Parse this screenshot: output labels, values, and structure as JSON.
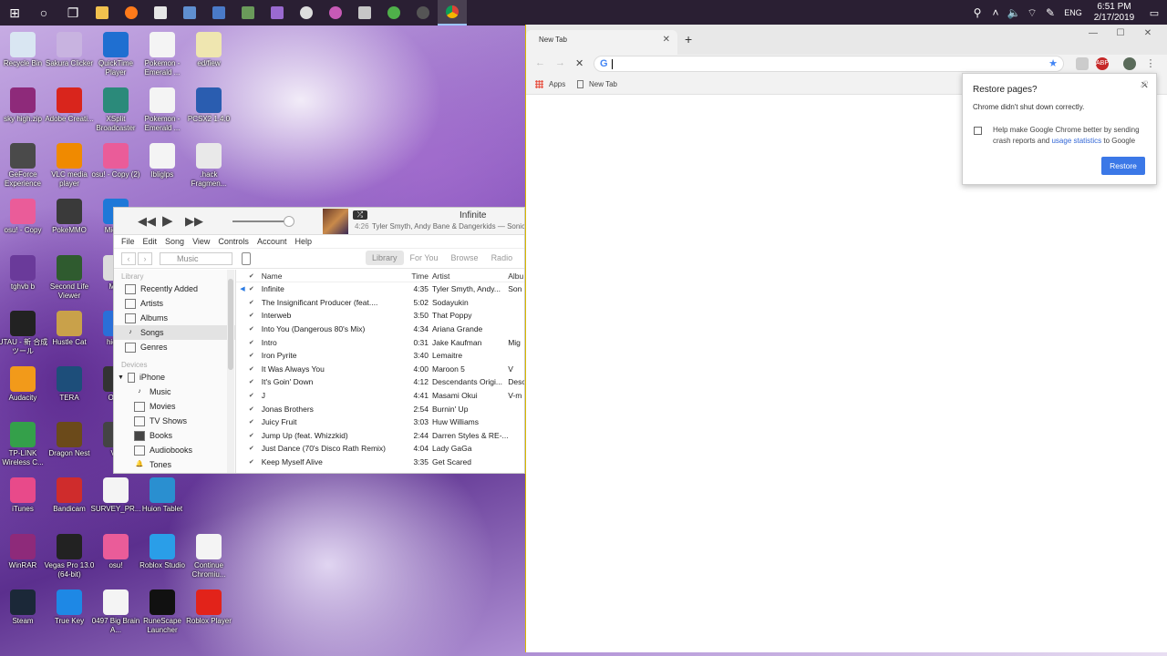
{
  "taskbar": {
    "apps": [
      "windows-start",
      "cortana",
      "task-view",
      "file-explorer",
      "firefox",
      "store",
      "app-1",
      "app-2",
      "app-3",
      "app-4",
      "itunes",
      "app-5",
      "app-6",
      "app-7",
      "app-8",
      "chrome"
    ],
    "tray": {
      "lang": "ENG",
      "time": "6:51 PM",
      "date": "2/17/2019"
    }
  },
  "desktop": {
    "icons": [
      {
        "label": "Recycle Bin",
        "color": "#d9e6f2"
      },
      {
        "label": "Sakura Clicker",
        "color": "#c8b3e0"
      },
      {
        "label": "QuickTime Player",
        "color": "#1f6fd1"
      },
      {
        "label": "Pokemon - Emerald ...",
        "color": "#f4f4f4"
      },
      {
        "label": "ed/fiew",
        "color": "#efe6b0"
      },
      {
        "label": "sky high.zip",
        "color": "#8e2a7a"
      },
      {
        "label": "Adobe Creati...",
        "color": "#d9251c"
      },
      {
        "label": "XSplit Broadcaster",
        "color": "#2b8a7a"
      },
      {
        "label": "Pokemon - Emerald ...",
        "color": "#f4f4f4"
      },
      {
        "label": "PCSX2 1.4.0",
        "color": "#2a5db0"
      },
      {
        "label": "GeForce Experience",
        "color": "#4a4a4a"
      },
      {
        "label": "VLC media player",
        "color": "#f08a00"
      },
      {
        "label": "osu! - Copy (2)",
        "color": "#ea5c99"
      },
      {
        "label": "lbliglps",
        "color": "#f4f4f4"
      },
      {
        "label": ".hack Fragmen...",
        "color": "#e9e9e9"
      },
      {
        "label": "osu! - Copy",
        "color": "#ea5c99"
      },
      {
        "label": "PokeMMO",
        "color": "#3a3a3a"
      },
      {
        "label": "Mic Ed",
        "color": "#1e78d8"
      },
      {
        "label": "tghvb b",
        "color": "#6a3a9a"
      },
      {
        "label": "Second Life Viewer",
        "color": "#2f5b2f"
      },
      {
        "label": "My I",
        "color": "#dcdcdc"
      },
      {
        "label": "UTAU - 新 合成ツール",
        "color": "#222222"
      },
      {
        "label": "Hustle Cat",
        "color": "#c9a14a"
      },
      {
        "label": "hide.r",
        "color": "#2a6fd8"
      },
      {
        "label": "Audacity",
        "color": "#f29a1a"
      },
      {
        "label": "TERA",
        "color": "#1d4e7a"
      },
      {
        "label": "OBS",
        "color": "#333333"
      },
      {
        "label": "TP-LINK Wireless C...",
        "color": "#34a04a"
      },
      {
        "label": "Dragon Nest",
        "color": "#6b4a1a"
      },
      {
        "label": "VR",
        "color": "#444444"
      },
      {
        "label": "iTunes",
        "color": "#e84a8a"
      },
      {
        "label": "Bandicam",
        "color": "#cf2c2c"
      },
      {
        "label": "SURVEY_PR...",
        "color": "#f4f4f4"
      },
      {
        "label": "Huion Tablet",
        "color": "#2a8fd0"
      },
      {
        "label": "WinRAR",
        "color": "#8e2a7a"
      },
      {
        "label": "Vegas Pro 13.0 (64-bit)",
        "color": "#222222"
      },
      {
        "label": "osu!",
        "color": "#ea5c99"
      },
      {
        "label": "Roblox Studio",
        "color": "#2a9ee8"
      },
      {
        "label": "Continue Chromiu...",
        "color": "#f4f4f4"
      },
      {
        "label": "Steam",
        "color": "#1b2838"
      },
      {
        "label": "True Key",
        "color": "#1e88e5"
      },
      {
        "label": "0497 Big Brain A...",
        "color": "#f4f4f4"
      },
      {
        "label": "RuneScape Launcher",
        "color": "#111111"
      },
      {
        "label": "Roblox Player",
        "color": "#e2231a"
      }
    ]
  },
  "itunes": {
    "now_playing": {
      "title": "Infinite",
      "subtitle": "Tyler Smyth, Andy Bane & Dangerkids — Sonic Force",
      "duration": "4:26"
    },
    "menu": [
      "File",
      "Edit",
      "Song",
      "View",
      "Controls",
      "Account",
      "Help"
    ],
    "media_select": "Music",
    "tabs": [
      "Library",
      "For You",
      "Browse",
      "Radio"
    ],
    "sidebar": {
      "library_header": "Library",
      "library": [
        "Recently Added",
        "Artists",
        "Albums",
        "Songs",
        "Genres"
      ],
      "devices_header": "Devices",
      "device": "iPhone",
      "device_items": [
        "Music",
        "Movies",
        "TV Shows",
        "Books",
        "Audiobooks",
        "Tones"
      ]
    },
    "columns": {
      "name": "Name",
      "time": "Time",
      "artist": "Artist",
      "album": "Albu"
    },
    "songs": [
      {
        "name": "Infinite",
        "time": "4:35",
        "artist": "Tyler Smyth, Andy...",
        "album": "Son",
        "playing": true
      },
      {
        "name": "The Insignificant Producer (feat....",
        "time": "5:02",
        "artist": "Sodayukin",
        "album": ""
      },
      {
        "name": "Interweb",
        "time": "3:50",
        "artist": "That Poppy",
        "album": ""
      },
      {
        "name": "Into You (Dangerous 80's Mix)",
        "time": "4:34",
        "artist": "Ariana Grande",
        "album": ""
      },
      {
        "name": "Intro",
        "time": "0:31",
        "artist": "Jake Kaufman",
        "album": "Mig"
      },
      {
        "name": "Iron Pyrite",
        "time": "3:40",
        "artist": "Lemaitre",
        "album": ""
      },
      {
        "name": "It Was Always You",
        "time": "4:00",
        "artist": "Maroon 5",
        "album": "V"
      },
      {
        "name": "It's Goin' Down",
        "time": "4:12",
        "artist": "Descendants Origi...",
        "album": "Desc"
      },
      {
        "name": "J",
        "time": "4:41",
        "artist": "Masami Okui",
        "album": "V-m"
      },
      {
        "name": "Jonas Brothers",
        "time": "2:54",
        "artist": "Burnin' Up",
        "album": ""
      },
      {
        "name": "Juicy Fruit",
        "time": "3:03",
        "artist": "Huw Williams",
        "album": ""
      },
      {
        "name": "Jump Up (feat. Whizzkid)",
        "time": "2:44",
        "artist": "Darren Styles & RE-...",
        "album": ""
      },
      {
        "name": "Just Dance (70's Disco Rath Remix)",
        "time": "4:04",
        "artist": "Lady GaGa",
        "album": ""
      },
      {
        "name": "Keep Myself Alive",
        "time": "3:35",
        "artist": "Get Scared",
        "album": ""
      }
    ]
  },
  "chrome": {
    "tab_title": "New Tab",
    "bookmarks": {
      "apps": "Apps",
      "new_tab": "New Tab"
    },
    "restore_dialog": {
      "title": "Restore pages?",
      "message": "Chrome didn't shut down correctly.",
      "help_before": "Help make Google Chrome better by sending crash reports and ",
      "help_link": "usage statistics",
      "help_after": " to Google",
      "button": "Restore"
    }
  }
}
